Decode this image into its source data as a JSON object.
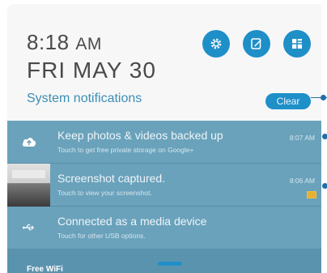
{
  "header": {
    "time": "8:18",
    "ampm": "AM",
    "date": "FRI MAY 30",
    "section_title": "System notifications",
    "clear_label": "Clear"
  },
  "quick_settings": [
    {
      "icon": "settings-gear-icon"
    },
    {
      "icon": "edit-note-icon"
    },
    {
      "icon": "grid-toggle-icon"
    }
  ],
  "notifications": [
    {
      "icon": "cloud-upload-icon",
      "title": "Keep photos & videos backed up",
      "subtitle": "Touch to get free private storage on Google+",
      "time": "8:07 AM"
    },
    {
      "icon": "screenshot-thumbnail",
      "title": "Screenshot captured.",
      "subtitle": "Touch to view your screenshot.",
      "time": "8:06 AM"
    },
    {
      "icon": "usb-icon",
      "title": "Connected as a media device",
      "subtitle": "Touch for other USB options.",
      "time": ""
    }
  ],
  "footer": {
    "network": "Free WiFi"
  },
  "colors": {
    "accent": "#1f8fc8",
    "header_bg": "#f7f7f8",
    "notification_bg": "#6aa2bb"
  }
}
